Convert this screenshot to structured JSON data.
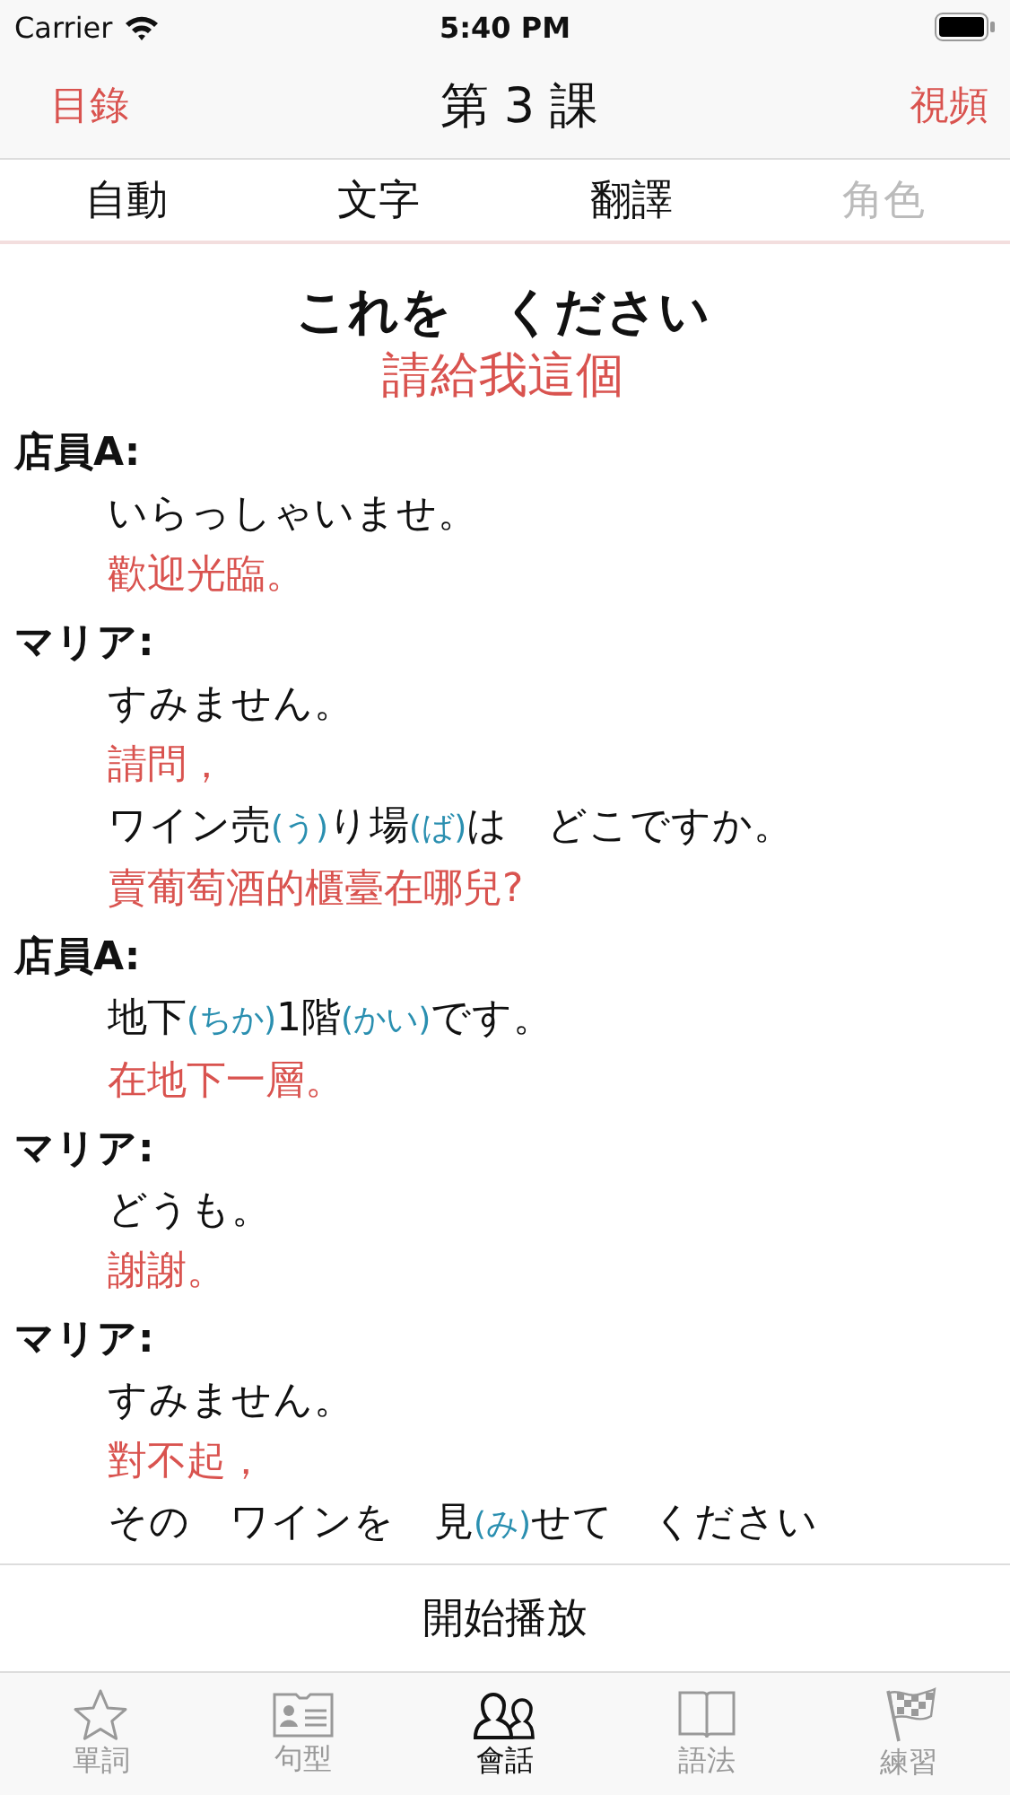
{
  "status_bar": {
    "carrier": "Carrier",
    "time": "5:40 PM"
  },
  "nav": {
    "left": "目錄",
    "title": "第 3 課",
    "right": "視頻"
  },
  "segments": [
    {
      "label": "自動",
      "disabled": false
    },
    {
      "label": "文字",
      "disabled": false
    },
    {
      "label": "翻譯",
      "disabled": false
    },
    {
      "label": "角色",
      "disabled": true
    }
  ],
  "dialogue": {
    "title": "これを　ください",
    "subtitle": "請給我這個",
    "turns": [
      {
        "speaker": "店員A:",
        "lines": [
          {
            "kind": "japanese",
            "parts": [
              {
                "kind": "base",
                "text": "いらっしゃいませ。"
              }
            ]
          },
          {
            "kind": "translation",
            "text": "歡迎光臨。"
          }
        ]
      },
      {
        "speaker": "マリア:",
        "lines": [
          {
            "kind": "japanese",
            "parts": [
              {
                "kind": "base",
                "text": "すみません。"
              }
            ]
          },
          {
            "kind": "translation",
            "text": "請問，"
          },
          {
            "kind": "japanese",
            "parts": [
              {
                "kind": "base",
                "text": "ワイン売"
              },
              {
                "kind": "reading",
                "text": "(う)"
              },
              {
                "kind": "base",
                "text": "り場"
              },
              {
                "kind": "reading",
                "text": "(ば)"
              },
              {
                "kind": "base",
                "text": "は　どこですか。"
              }
            ]
          },
          {
            "kind": "translation",
            "text": "賣葡萄酒的櫃臺在哪兒?"
          }
        ]
      },
      {
        "speaker": "店員A:",
        "lines": [
          {
            "kind": "japanese",
            "parts": [
              {
                "kind": "base",
                "text": "地下"
              },
              {
                "kind": "reading",
                "text": "(ちか)"
              },
              {
                "kind": "base",
                "text": "1階"
              },
              {
                "kind": "reading",
                "text": "(かい)"
              },
              {
                "kind": "base",
                "text": "です。"
              }
            ]
          },
          {
            "kind": "translation",
            "text": "在地下一層。"
          }
        ]
      },
      {
        "speaker": "マリア:",
        "lines": [
          {
            "kind": "japanese",
            "parts": [
              {
                "kind": "base",
                "text": "どうも。"
              }
            ]
          },
          {
            "kind": "translation",
            "text": "謝謝。"
          }
        ]
      },
      {
        "speaker": "マリア:",
        "lines": [
          {
            "kind": "japanese",
            "parts": [
              {
                "kind": "base",
                "text": "すみません。"
              }
            ]
          },
          {
            "kind": "translation",
            "text": "對不起，"
          },
          {
            "kind": "japanese",
            "parts": [
              {
                "kind": "base",
                "text": "その　ワインを　見"
              },
              {
                "kind": "reading",
                "text": "(み)"
              },
              {
                "kind": "base",
                "text": "せて　ください"
              }
            ]
          }
        ]
      }
    ]
  },
  "play_button": "開始播放",
  "tab_bar": [
    {
      "label": "單詞",
      "selected": false
    },
    {
      "label": "句型",
      "selected": false
    },
    {
      "label": "會話",
      "selected": true
    },
    {
      "label": "語法",
      "selected": false
    },
    {
      "label": "練習",
      "selected": false
    }
  ]
}
